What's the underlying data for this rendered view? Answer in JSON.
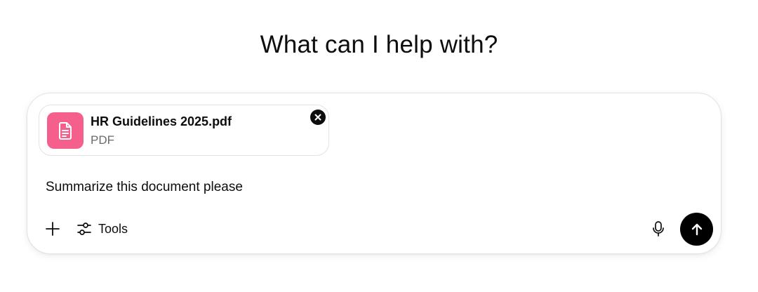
{
  "heading": "What can I help with?",
  "composer": {
    "attachment": {
      "file_name": "HR Guidelines 2025.pdf",
      "file_type": "PDF",
      "icon": "document-icon",
      "thumb_color": "#f55f8b"
    },
    "prompt_text": "Summarize this document please",
    "toolbar": {
      "tools_label": "Tools"
    }
  },
  "colors": {
    "accent": "#000000",
    "file_thumb": "#f55f8b"
  }
}
